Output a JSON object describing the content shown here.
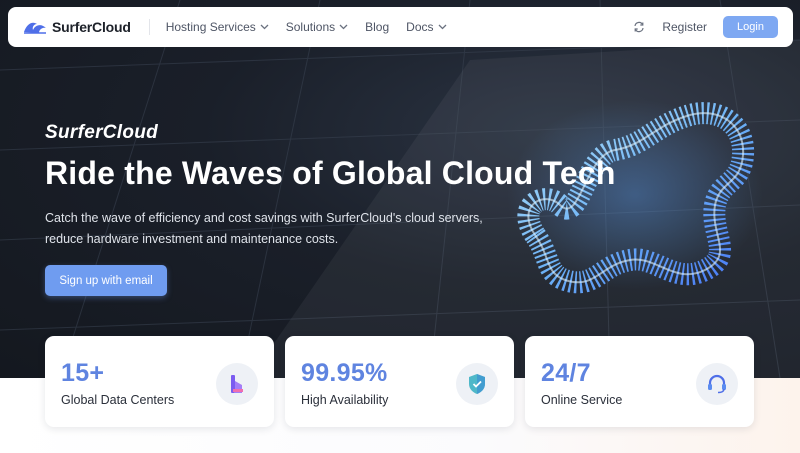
{
  "nav": {
    "brand": "SurferCloud",
    "items": [
      {
        "label": "Hosting Services",
        "has_dropdown": true
      },
      {
        "label": "Solutions",
        "has_dropdown": true
      },
      {
        "label": "Blog",
        "has_dropdown": false
      },
      {
        "label": "Docs",
        "has_dropdown": true
      }
    ],
    "register": "Register",
    "login": "Login"
  },
  "hero": {
    "brand_italic": "SurferCloud",
    "title": "Ride the Waves of Global Cloud Tech",
    "description": "Catch the wave of efficiency and cost savings with SurferCloud's cloud servers, reduce hardware investment and maintenance costs.",
    "cta": "Sign up with email"
  },
  "stats": [
    {
      "value": "15+",
      "label": "Global Data Centers",
      "icon": "data-center-icon"
    },
    {
      "value": "99.95%",
      "label": "High Availability",
      "icon": "shield-check-icon"
    },
    {
      "value": "24/7",
      "label": "Online Service",
      "icon": "headset-icon"
    }
  ],
  "colors": {
    "accent": "#6f9cf0",
    "stat_value": "#5f84e0",
    "hero_bg": "#1a1f29",
    "nav_text": "#4e5565"
  }
}
